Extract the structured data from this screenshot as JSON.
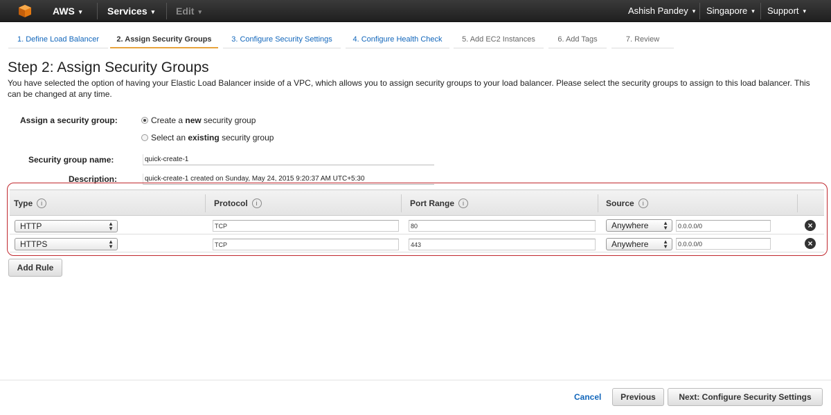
{
  "topbar": {
    "brand": "AWS",
    "services": "Services",
    "edit": "Edit",
    "user": "Ashish Pandey",
    "region": "Singapore",
    "support": "Support",
    "caret": "▾"
  },
  "wizard": {
    "tabs": [
      {
        "label": "1. Define Load Balancer"
      },
      {
        "label": "2. Assign Security Groups"
      },
      {
        "label": "3. Configure Security Settings"
      },
      {
        "label": "4. Configure Health Check"
      },
      {
        "label": "5. Add EC2 Instances"
      },
      {
        "label": "6. Add Tags"
      },
      {
        "label": "7. Review"
      }
    ]
  },
  "page": {
    "title": "Step 2: Assign Security Groups",
    "intro": "You have selected the option of having your Elastic Load Balancer inside of a VPC, which allows you to assign security groups to your load balancer. Please select the security groups to assign to this load balancer. This can be changed at any time."
  },
  "form": {
    "assign_label": "Assign a security group:",
    "option_new_prefix": "Create a ",
    "option_new_bold": "new",
    "option_new_suffix": " security group",
    "option_existing_prefix": "Select an ",
    "option_existing_bold": "existing",
    "option_existing_suffix": " security group",
    "name_label": "Security group name:",
    "name_value": "quick-create-1",
    "desc_label": "Description:",
    "desc_value": "quick-create-1 created on Sunday, May 24, 2015 9:20:37 AM UTC+5:30"
  },
  "rules": {
    "headers": {
      "type": "Type",
      "protocol": "Protocol",
      "port_range": "Port Range",
      "source": "Source",
      "info": "i"
    },
    "rows": [
      {
        "type": "HTTP",
        "protocol": "TCP",
        "port": "80",
        "source": "Anywhere",
        "cidr": "0.0.0.0/0"
      },
      {
        "type": "HTTPS",
        "protocol": "TCP",
        "port": "443",
        "source": "Anywhere",
        "cidr": "0.0.0.0/0"
      }
    ],
    "add_rule": "Add Rule",
    "remove_glyph": "×"
  },
  "footer": {
    "cancel": "Cancel",
    "previous": "Previous",
    "next": "Next: Configure Security Settings"
  },
  "colors": {
    "highlight_outline": "#c0272d",
    "active_tab_underline": "#e8a33c",
    "link": "#1166bb",
    "topbar": "#2b2b2b"
  }
}
